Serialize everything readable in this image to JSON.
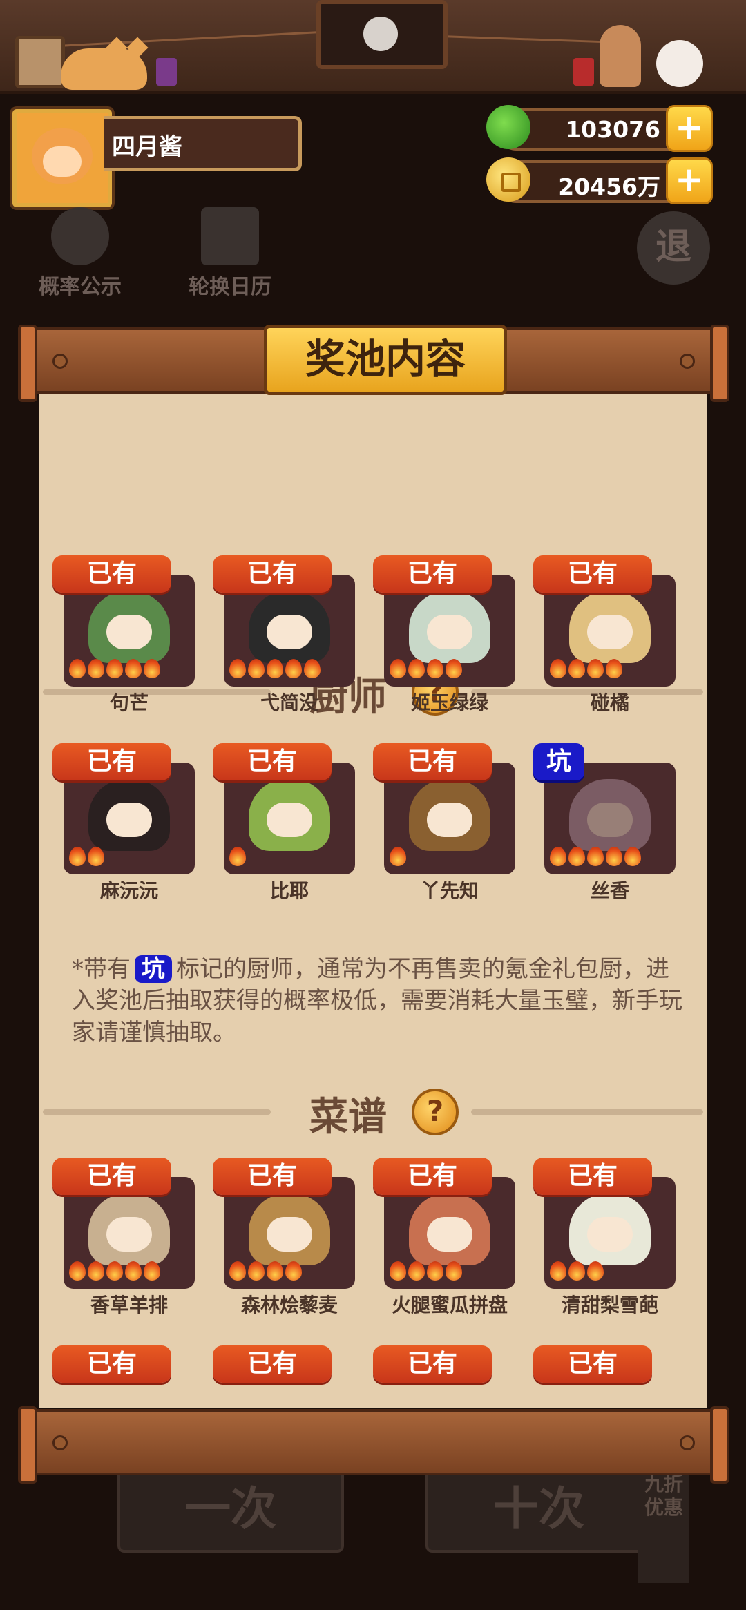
{
  "header": {
    "player_name": "四月酱",
    "jade": "103076",
    "coins": "20456万",
    "plus": "+"
  },
  "background": {
    "probability_label": "概率公示",
    "calendar_label": "轮换日历",
    "exit_label": "退",
    "bottom_left": "一次",
    "bottom_right": "十次",
    "side_promo": "九折优惠"
  },
  "modal": {
    "title": "奖池内容",
    "chefs_section": "厨师",
    "recipes_section": "菜谱",
    "help_icon": "?",
    "note_before": "*带有",
    "note_badge": "坑",
    "note_after": "标记的厨师，通常为不再售卖的氪金礼包厨，进入奖池后抽取获得的概率极低，需要消耗大量玉璧，新手玩家请谨慎抽取。",
    "chefs": [
      {
        "name": "句芒",
        "badge": "已有",
        "stars": 5,
        "color": "#5a8a4a"
      },
      {
        "name": "弋简没",
        "badge": "已有",
        "stars": 5,
        "color": "#2a2a2a"
      },
      {
        "name": "姬玉绿绿",
        "badge": "已有",
        "stars": 4,
        "color": "#c8d8c8"
      },
      {
        "name": "碰橘",
        "badge": "已有",
        "stars": 4,
        "color": "#e0c080"
      },
      {
        "name": "麻沅沅",
        "badge": "已有",
        "stars": 2,
        "color": "#2a2020"
      },
      {
        "name": "比耶",
        "badge": "已有",
        "stars": 1,
        "color": "#8ab04a"
      },
      {
        "name": "丫先知",
        "badge": "已有",
        "stars": 1,
        "color": "#8a6030"
      },
      {
        "name": "丝香",
        "badge": "坑",
        "stars": 5,
        "color": "#b89aa8"
      }
    ],
    "recipes": [
      {
        "name": "香草羊排",
        "badge": "已有",
        "stars": 5,
        "color": "#c8b090"
      },
      {
        "name": "森林烩藜麦",
        "badge": "已有",
        "stars": 4,
        "color": "#b88a4a"
      },
      {
        "name": "火腿蜜瓜拼盘",
        "badge": "已有",
        "stars": 4,
        "color": "#c87050"
      },
      {
        "name": "清甜梨雪葩",
        "badge": "已有",
        "stars": 3,
        "color": "#e8e8d8"
      }
    ],
    "partial_badge": "已有"
  }
}
